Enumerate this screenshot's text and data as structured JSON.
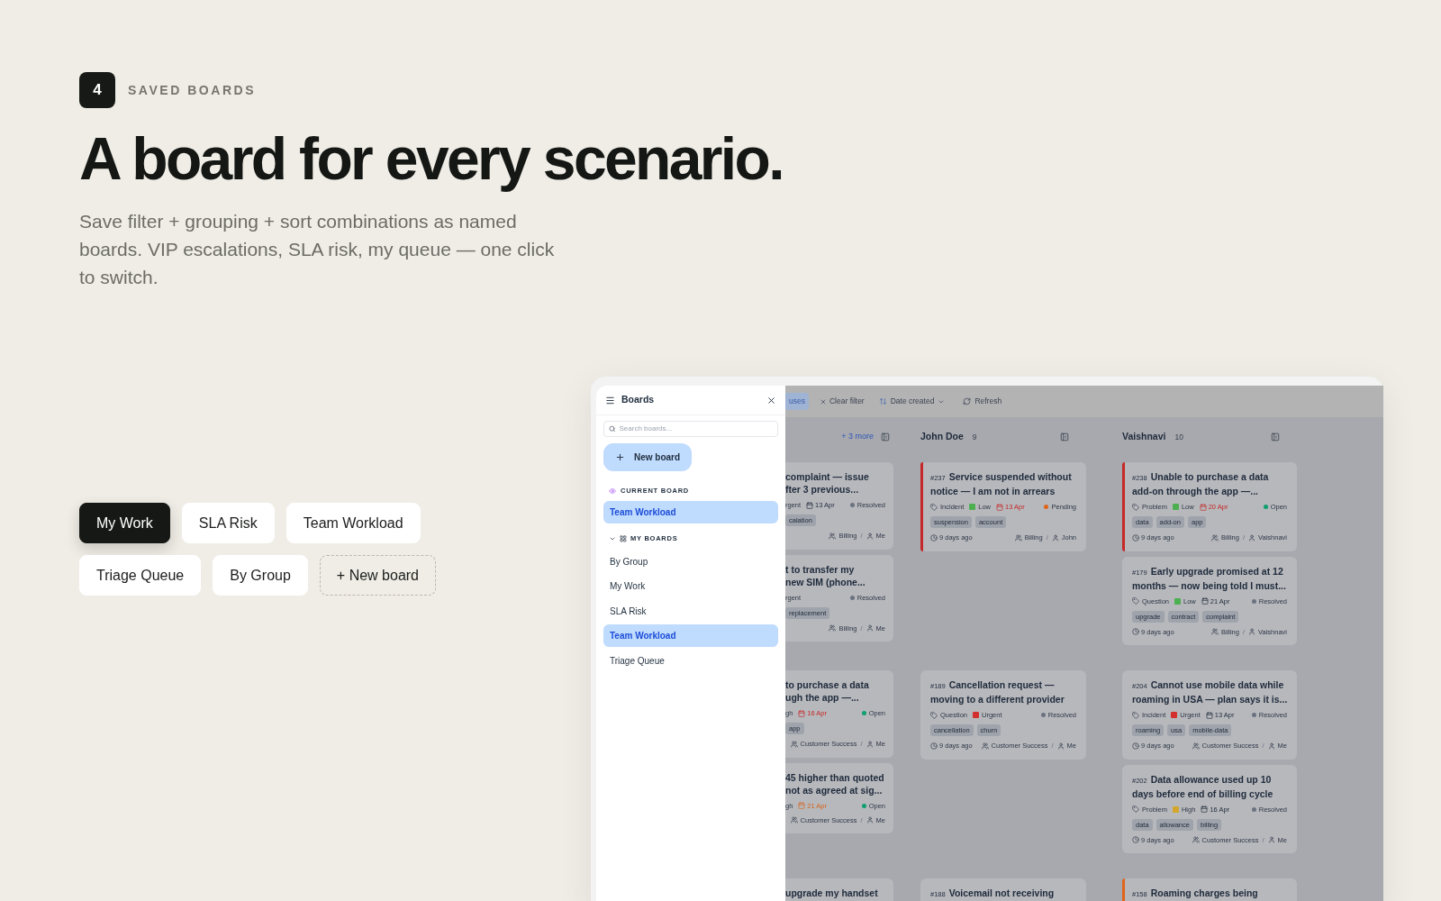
{
  "section": {
    "number": "4",
    "eyebrow": "SAVED BOARDS",
    "heading": "A board for every scenario.",
    "description": "Save filter + grouping + sort combinations as named boards. VIP escalations, SLA risk, my queue — one click to switch."
  },
  "board_chips": [
    {
      "label": "My Work",
      "selected": true,
      "kind": "board"
    },
    {
      "label": "SLA Risk",
      "selected": false,
      "kind": "board"
    },
    {
      "label": "Team Workload",
      "selected": false,
      "kind": "board"
    },
    {
      "label": "Triage Queue",
      "selected": false,
      "kind": "board"
    },
    {
      "label": "By Group",
      "selected": false,
      "kind": "board"
    },
    {
      "label": "+ New board",
      "kind": "new"
    }
  ],
  "sidebar": {
    "title": "Boards",
    "search_placeholder": "Search boards...",
    "new_board": "New board",
    "current_label": "CURRENT BOARD",
    "current": {
      "label": "Team Workload",
      "selected": true
    },
    "group_label": "MY BOARDS",
    "group_expanded": true,
    "items": [
      {
        "label": "By Group",
        "selected": false
      },
      {
        "label": "My Work",
        "selected": false
      },
      {
        "label": "SLA Risk",
        "selected": false
      },
      {
        "label": "Team Workload",
        "selected": true
      },
      {
        "label": "Triage Queue",
        "selected": false
      }
    ]
  },
  "toolbar": {
    "chip": "uses",
    "clear": "Clear filter",
    "sort": "Date created",
    "refresh": "Refresh"
  },
  "columns": [
    {
      "clipped": true,
      "more": "+ 3 more"
    },
    {
      "clipped": false,
      "name": "John Doe",
      "count": "9"
    },
    {
      "clipped": false,
      "name": "Vaishnavi",
      "count": "10"
    }
  ],
  "lanes": [
    {
      "cells": [
        [
          {
            "title_lines": [
              "complaint — issue",
              "fter 3 previous..."
            ],
            "priority": {
              "label": "rgent"
            },
            "due": {
              "label": "13 Apr",
              "overdue": false,
              "warning": false
            },
            "status": {
              "label": "Resolved",
              "color": "#6b7280"
            },
            "tags": [
              "calation"
            ],
            "group": "Billing",
            "separator": "/",
            "assignee": "Me"
          },
          {
            "title_lines": [
              "t to transfer my",
              "new SIM (phone..."
            ],
            "priority": {
              "label": "rgent"
            },
            "status": {
              "label": "Resolved",
              "color": "#6b7280"
            },
            "tags": [
              "replacement"
            ],
            "group": "Billing",
            "separator": "/",
            "assignee": "Me"
          }
        ],
        [
          {
            "number": "#237",
            "title_lines": [
              "Service suspended without",
              "notice — I am not in arrears"
            ],
            "accent": {
              "color": "#c62828"
            },
            "type": "Incident",
            "priority": {
              "label": "Low",
              "color": "#4caf50"
            },
            "due": {
              "label": "13 Apr",
              "overdue": true
            },
            "status": {
              "label": "Pending",
              "color": "#e0651b"
            },
            "tags": [
              "suspension",
              "account"
            ],
            "age": "9 days ago",
            "group": "Billing",
            "separator": "/",
            "assignee": "John"
          }
        ],
        [
          {
            "number": "#238",
            "title_lines": [
              "Unable to purchase a data",
              "add-on through the app —..."
            ],
            "accent": {
              "color": "#c62828"
            },
            "type": "Problem",
            "priority": {
              "label": "Low",
              "color": "#4caf50"
            },
            "due": {
              "label": "20 Apr",
              "overdue": true
            },
            "status": {
              "label": "Open",
              "color": "#0e9f6e"
            },
            "tags": [
              "data",
              "add-on",
              "app"
            ],
            "age": "9 days ago",
            "group": "Billing",
            "separator": "/",
            "assignee": "Vaishnavi"
          },
          {
            "number": "#179",
            "title_lines": [
              "Early upgrade promised at 12",
              "months — now being told I must..."
            ],
            "type": "Question",
            "priority": {
              "label": "Low",
              "color": "#4caf50"
            },
            "due": {
              "label": "21 Apr",
              "overdue": false,
              "warning": false
            },
            "status": {
              "label": "Resolved",
              "color": "#6b7280"
            },
            "tags": [
              "upgrade",
              "contract",
              "complaint"
            ],
            "age": "9 days ago",
            "group": "Billing",
            "separator": "/",
            "assignee": "Vaishnavi"
          }
        ]
      ]
    },
    {
      "cells": [
        [
          {
            "title_lines": [
              "to purchase a data",
              "ugh the app —..."
            ],
            "priority": {
              "label": "gh"
            },
            "due": {
              "label": "16 Apr",
              "overdue": true
            },
            "status": {
              "label": "Open",
              "color": "#0e9f6e"
            },
            "tags": [
              "app"
            ],
            "group": "Customer Success",
            "separator": "/",
            "assignee": "Me"
          },
          {
            "title_lines": [
              "45 higher than quoted",
              "not as agreed at sig..."
            ],
            "priority": {
              "label": "gh"
            },
            "due": {
              "label": "21 Apr",
              "overdue": false,
              "warning": true
            },
            "status": {
              "label": "Open",
              "color": "#0e9f6e"
            },
            "group": "Customer Success",
            "separator": "/",
            "assignee": "Me"
          }
        ],
        [
          {
            "number": "#189",
            "title_lines": [
              "Cancellation request —",
              "moving to a different provider"
            ],
            "type": "Question",
            "priority": {
              "label": "Urgent",
              "color": "#d32f2f"
            },
            "status": {
              "label": "Resolved",
              "color": "#6b7280"
            },
            "tags": [
              "cancellation",
              "churn"
            ],
            "age": "9 days ago",
            "group": "Customer Success",
            "separator": "/",
            "assignee": "Me"
          }
        ],
        [
          {
            "number": "#204",
            "title_lines": [
              "Cannot use mobile data while",
              "roaming in USA — plan says it is..."
            ],
            "type": "Incident",
            "priority": {
              "label": "Urgent",
              "color": "#d32f2f"
            },
            "due": {
              "label": "13 Apr",
              "overdue": false,
              "warning": false
            },
            "status": {
              "label": "Resolved",
              "color": "#6b7280"
            },
            "tags": [
              "roaming",
              "usa",
              "mobile-data"
            ],
            "age": "9 days ago",
            "group": "Customer Success",
            "separator": "/",
            "assignee": "Me"
          },
          {
            "number": "#202",
            "title_lines": [
              "Data allowance used up 10",
              "days before end of billing cycle"
            ],
            "type": "Problem",
            "priority": {
              "label": "High",
              "color": "#d4a72c"
            },
            "due": {
              "label": "16 Apr",
              "overdue": false,
              "warning": false
            },
            "status": {
              "label": "Resolved",
              "color": "#6b7280"
            },
            "tags": [
              "data",
              "allowance",
              "billing"
            ],
            "age": "9 days ago",
            "group": "Customer Success",
            "separator": "/",
            "assignee": "Me"
          }
        ]
      ]
    },
    {
      "cells": [
        [
          {
            "title_lines": [
              "upgrade my handset"
            ]
          }
        ],
        [
          {
            "number": "#188",
            "title_lines": [
              "Voicemail not receiving"
            ]
          }
        ],
        [
          {
            "number": "#158",
            "title_lines": [
              "Roaming charges being"
            ],
            "accent": {
              "color": "#e0651b"
            }
          }
        ]
      ]
    }
  ]
}
